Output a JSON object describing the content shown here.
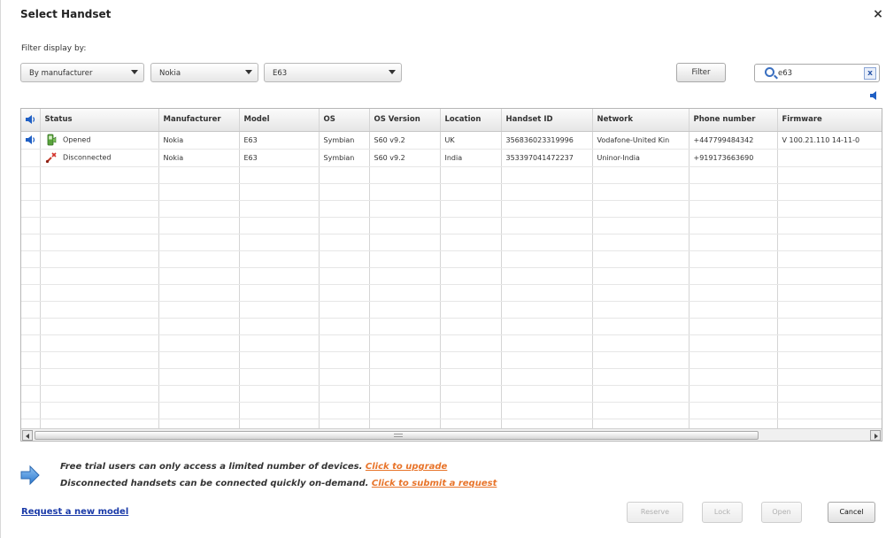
{
  "dialog": {
    "title": "Select Handset",
    "close_label": "×"
  },
  "filters": {
    "label": "Filter display by:",
    "dropdown1": "By manufacturer",
    "dropdown2": "Nokia",
    "dropdown3": "E63",
    "filter_button": "Filter",
    "search_value": "e63",
    "clear_label": "x"
  },
  "table": {
    "columns": [
      "",
      "Status",
      "Manufacturer",
      "Model",
      "OS",
      "OS Version",
      "Location",
      "Handset ID",
      "Network",
      "Phone number",
      "Firmware"
    ],
    "rows": [
      {
        "status": "Opened",
        "status_icon": "opened-handset-icon",
        "manufacturer": "Nokia",
        "model": "E63",
        "os": "Symbian",
        "os_version": "S60 v9.2",
        "location": "UK",
        "handset_id": "356836023319996",
        "network": "Vodafone-United Kin",
        "phone": "+447799484342",
        "firmware": "V 100.21.110 14-11-0"
      },
      {
        "status": "Disconnected",
        "status_icon": "disconnected-handset-icon",
        "manufacturer": "Nokia",
        "model": "E63",
        "os": "Symbian",
        "os_version": "S60 v9.2",
        "location": "India",
        "handset_id": "353397041472237",
        "network": "Uninor-India",
        "phone": "+919173663690",
        "firmware": ""
      }
    ]
  },
  "notice": {
    "line1": "Free trial users can only access a limited number of devices.",
    "line1_link": "Click to upgrade",
    "line2": "Disconnected handsets can be connected quickly on-demand.",
    "line2_link": "Click to submit a request"
  },
  "footer": {
    "request_link": "Request a new model",
    "reserve": "Reserve",
    "lock": "Lock",
    "open": "Open",
    "cancel": "Cancel"
  },
  "colors": {
    "link_orange": "#e8742a",
    "link_blue": "#1a3aa8",
    "speaker_blue": "#1f5fc4"
  }
}
